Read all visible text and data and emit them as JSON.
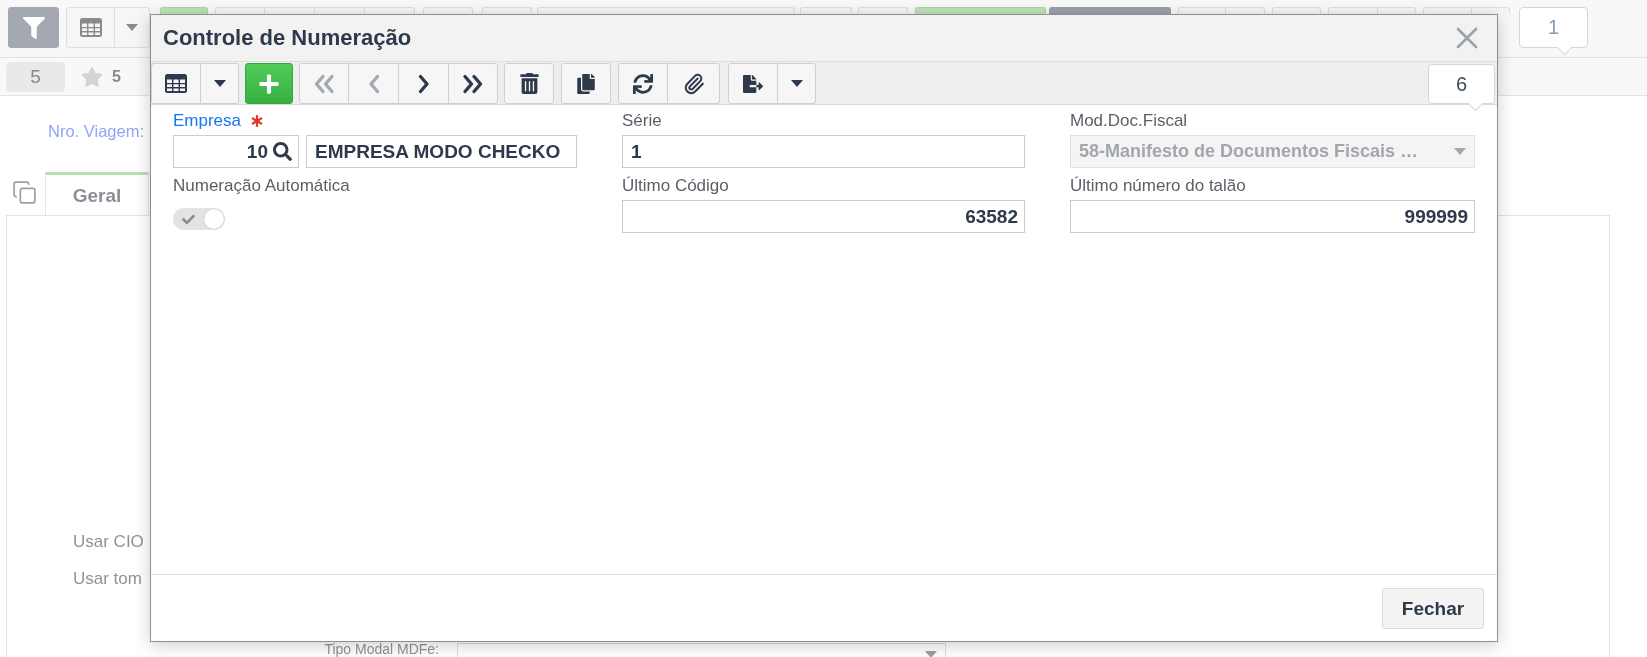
{
  "page": {
    "count_bubble": "1",
    "count_badge": "5",
    "favorites_count": "5",
    "field_label": "Nro. Viagem:",
    "tabs": [
      {
        "label": "Geral",
        "selected": true
      }
    ],
    "form_rows": [
      {
        "kind": "label",
        "label": "Usar CIO"
      },
      {
        "kind": "label",
        "label": "Usar tom"
      },
      {
        "kind": "select",
        "label": "Tipo Modal MDFe:"
      }
    ]
  },
  "dialog": {
    "title": "Controle de Numeração",
    "toolbar": {
      "groups": [
        {
          "buttons": [
            {
              "kind": "grid",
              "disabled": false
            },
            {
              "kind": "dropdown",
              "disabled": false
            }
          ]
        },
        {
          "buttons": [
            {
              "kind": "add",
              "disabled": false
            }
          ]
        },
        {
          "buttons": [
            {
              "kind": "first",
              "disabled": true
            },
            {
              "kind": "previous",
              "disabled": true
            },
            {
              "kind": "next",
              "disabled": false
            },
            {
              "kind": "last",
              "disabled": false
            }
          ]
        },
        {
          "buttons": [
            {
              "kind": "delete",
              "disabled": false
            }
          ]
        },
        {
          "buttons": [
            {
              "kind": "copy",
              "disabled": false
            }
          ]
        },
        {
          "buttons": [
            {
              "kind": "refresh",
              "disabled": false
            },
            {
              "kind": "attach",
              "disabled": false
            }
          ]
        },
        {
          "buttons": [
            {
              "kind": "export",
              "disabled": false
            },
            {
              "kind": "dropdown",
              "disabled": false
            }
          ]
        }
      ],
      "record_count": "6"
    },
    "fields": [
      {
        "kind": "lookup",
        "label": "Empresa",
        "required": true,
        "disabled": false,
        "code": "10",
        "description": "EMPRESA MODO CHECKO"
      },
      {
        "kind": "text",
        "label": "Série",
        "required": false,
        "disabled": false,
        "value": "1"
      },
      {
        "kind": "select",
        "label": "Mod.Doc.Fiscal",
        "required": false,
        "disabled": true,
        "value": "58-Manifesto de Documentos Fiscais …"
      },
      {
        "kind": "switch",
        "label": "Numeração Automática",
        "required": false,
        "disabled": true,
        "on": true
      },
      {
        "kind": "number",
        "label": "Último Código",
        "required": false,
        "disabled": false,
        "value": "63582"
      },
      {
        "kind": "number",
        "label": "Último número do talão",
        "required": false,
        "disabled": false,
        "value": "999999"
      }
    ],
    "buttons": [
      "Fechar"
    ]
  }
}
